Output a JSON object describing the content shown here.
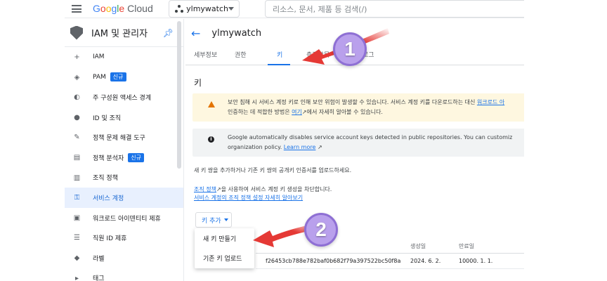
{
  "topbar": {
    "logo": [
      "G",
      "o",
      "o",
      "g",
      "l",
      "e",
      " ",
      "C",
      "l",
      "o",
      "u",
      "d"
    ],
    "logo_colors": [
      "#4285F4",
      "#EA4335",
      "#FBBC05",
      "#4285F4",
      "#34A853",
      "#EA4335",
      "",
      "#5f6368",
      "#5f6368",
      "#5f6368",
      "#5f6368",
      "#5f6368"
    ],
    "project": "ylmywatch",
    "search_placeholder": "리소스, 문서, 제품 등 검색(/)"
  },
  "sidebar": {
    "title": "IAM 및 관리자",
    "items": [
      {
        "label": "IAM",
        "icon": "person-add-icon",
        "glyph": "+"
      },
      {
        "label": "PAM",
        "icon": "shield-icon",
        "glyph": "◈",
        "badge": "신규"
      },
      {
        "label": "주 구성원 액세스 경계",
        "icon": "policy-icon",
        "glyph": "◐"
      },
      {
        "label": "ID 및 조직",
        "icon": "account-circle-icon",
        "glyph": "●"
      },
      {
        "label": "정책 문제 해결 도구",
        "icon": "wrench-icon",
        "glyph": "✎"
      },
      {
        "label": "정책 분석자",
        "icon": "document-search-icon",
        "glyph": "▤",
        "badge": "신규"
      },
      {
        "label": "조직 정책",
        "icon": "document-icon",
        "glyph": "▥"
      },
      {
        "label": "서비스 계정",
        "icon": "service-account-icon",
        "glyph": "⚿",
        "active": true
      },
      {
        "label": "워크로드 아이덴티티 제휴",
        "icon": "id-card-icon",
        "glyph": "▣"
      },
      {
        "label": "직원 ID 제휴",
        "icon": "list-icon",
        "glyph": "☰"
      },
      {
        "label": "라벨",
        "icon": "label-icon",
        "glyph": "◆"
      },
      {
        "label": "태그",
        "icon": "tag-icon",
        "glyph": "▸"
      }
    ]
  },
  "main": {
    "account": "ylmywatch",
    "tabs": [
      "세부정보",
      "권한",
      "키",
      "측정항목",
      "로그"
    ],
    "active_tab": "키",
    "section_title": "키",
    "warning": {
      "line1": "보안 침해 시 서비스 계정 키로 인해 보안 위험이 발생할 수 있습니다. 서비스 계정 키를 다운로드하는 대신 ",
      "line1_link": "워크로드 아",
      "line2": "인증하는 데 적합한 방법은 ",
      "line2_link": "여기",
      "line2_end": "에서 자세히 알아볼 수 있습니다."
    },
    "info": {
      "line1": "Google automatically disables service account keys detected in public repositories. You can customiz",
      "line2": "organization policy. ",
      "line2_link": "Learn more"
    },
    "para": "새 키 쌍을 추가하거나 기존 키 쌍의 공개키 인증서를 업로드하세요.",
    "policy_link": "조직 정책",
    "policy_text": "을 사용하여 서비스 계정 키 생성을 차단합니다.",
    "policy_link2": "서비스 계정의 조직 정책 설정 자세히 알아보기",
    "add_key": "키 추가",
    "menu": [
      "새 키 만들기",
      "기존 키 업로드"
    ],
    "table": {
      "headers": [
        "",
        "생성일",
        "만료일"
      ],
      "rows": [
        [
          "f26453cb788e782baf0b682f79a397522bc50f8a",
          "2024. 6. 2.",
          "10000. 1. 1."
        ]
      ]
    }
  },
  "annotations": {
    "step1": "1",
    "step2": "2",
    "arrow_color": "#e53935",
    "circle_color": "#b9a0ec"
  }
}
